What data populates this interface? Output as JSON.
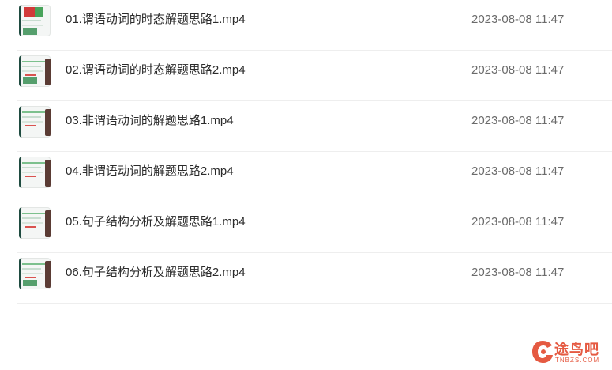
{
  "files": [
    {
      "name": "01.谓语动词的时态解题思路1.mp4",
      "modified": "2023-08-08 11:47"
    },
    {
      "name": "02.谓语动词的时态解题思路2.mp4",
      "modified": "2023-08-08 11:47"
    },
    {
      "name": "03.非谓语动词的解题思路1.mp4",
      "modified": "2023-08-08 11:47"
    },
    {
      "name": "04.非谓语动词的解题思路2.mp4",
      "modified": "2023-08-08 11:47"
    },
    {
      "name": "05.句子结构分析及解题思路1.mp4",
      "modified": "2023-08-08 11:47"
    },
    {
      "name": "06.句子结构分析及解题思路2.mp4",
      "modified": "2023-08-08 11:47"
    }
  ],
  "watermark": {
    "text": "途鸟吧",
    "subtext": "TNBZS.COM"
  },
  "colors": {
    "accent": "#e55a42",
    "thumb_green": "#3a8f55",
    "thumb_border": "#1f4b40"
  }
}
